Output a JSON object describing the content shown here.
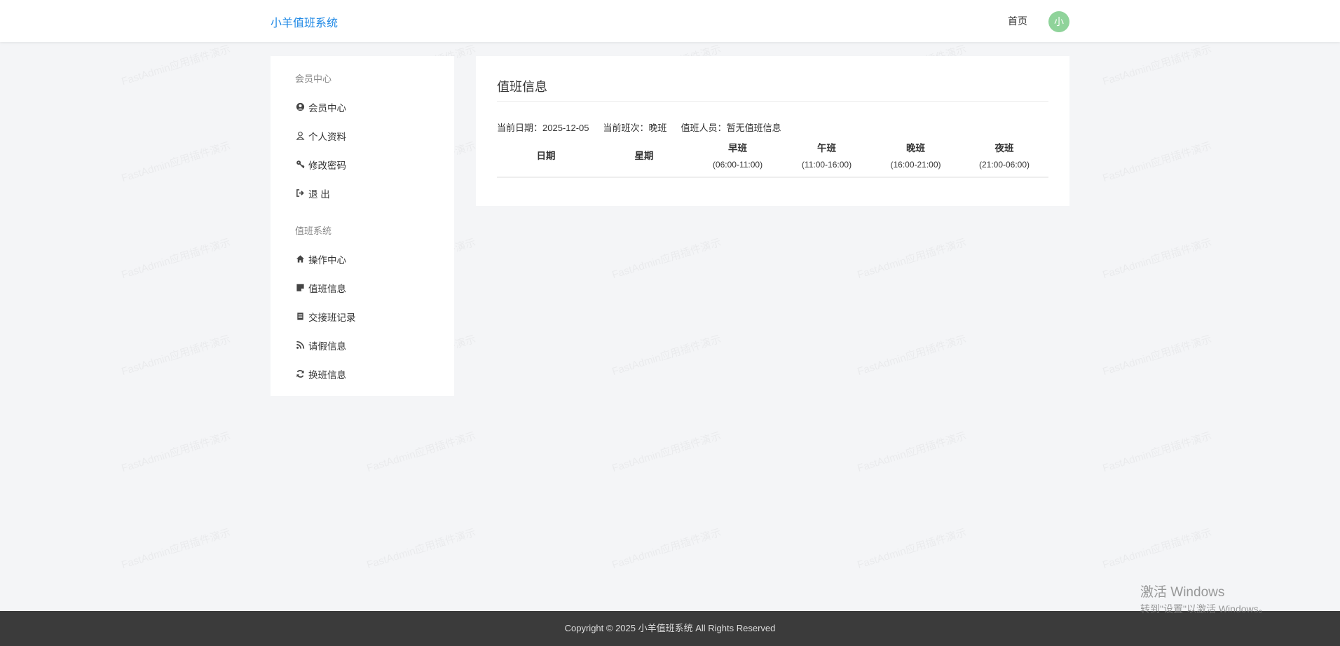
{
  "header": {
    "brand": "小羊值班系统",
    "nav_home": "首页",
    "avatar_initial": "小",
    "avatar_color": "#8fd39a",
    "brand_color": "#1e88e5"
  },
  "sidebar": {
    "section_member": "会员中心",
    "member_items": [
      {
        "label": "会员中心",
        "icon": "user-circle-icon"
      },
      {
        "label": "个人资料",
        "icon": "user-icon"
      },
      {
        "label": "修改密码",
        "icon": "key-icon"
      },
      {
        "label": "退 出",
        "icon": "sign-out-icon"
      }
    ],
    "section_duty": "值班系统",
    "duty_items": [
      {
        "label": "操作中心",
        "icon": "home-icon"
      },
      {
        "label": "值班信息",
        "icon": "sticky-note-icon"
      },
      {
        "label": "交接班记录",
        "icon": "list-icon"
      },
      {
        "label": "请假信息",
        "icon": "rss-icon"
      },
      {
        "label": "换班信息",
        "icon": "refresh-icon"
      }
    ]
  },
  "main": {
    "title": "值班信息",
    "current_date_label": "当前日期：",
    "current_date": "2025-12-05",
    "current_shift_label": "当前班次：",
    "current_shift": "晚班",
    "duty_person_label": "值班人员：",
    "duty_person": "暂无值班信息",
    "table": {
      "columns": [
        {
          "label": "日期",
          "sub": ""
        },
        {
          "label": "星期",
          "sub": ""
        },
        {
          "label": "早班",
          "sub": "(06:00-11:00)"
        },
        {
          "label": "午班",
          "sub": "(11:00-16:00)"
        },
        {
          "label": "晚班",
          "sub": "(16:00-21:00)"
        },
        {
          "label": "夜班",
          "sub": "(21:00-06:00)"
        }
      ],
      "rows": []
    }
  },
  "footer": {
    "copyright": "Copyright © 2025 小羊值班系统 All Rights Reserved"
  },
  "watermark": {
    "text": "FastAdmin应用插件演示"
  },
  "windows_activation": {
    "line1": "激活 Windows",
    "line2": "转到\"设置\"以激活 Windows。"
  }
}
